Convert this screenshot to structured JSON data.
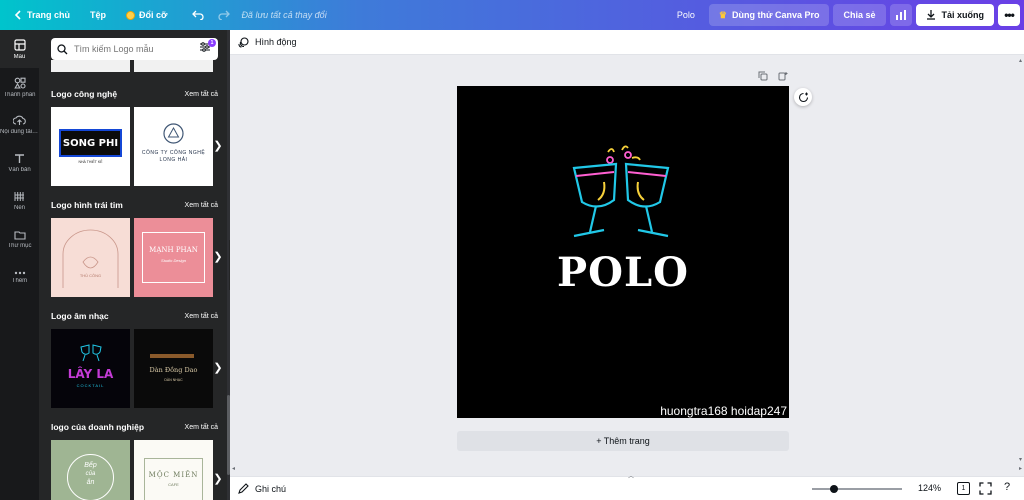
{
  "topbar": {
    "home": "Trang chủ",
    "file": "Tệp",
    "resize": "Đổi cỡ",
    "saved_status": "Đã lưu tất cả thay đổi",
    "design_title": "Polo",
    "try_pro": "Dùng thử Canva Pro",
    "share": "Chia sẻ",
    "download": "Tải xuống"
  },
  "rail": {
    "items": [
      {
        "label": "Mẫu",
        "icon": "template-icon"
      },
      {
        "label": "Thành phần",
        "icon": "elements-icon"
      },
      {
        "label": "Nội dung tải lên",
        "icon": "upload-icon"
      },
      {
        "label": "Văn bản",
        "icon": "text-icon"
      },
      {
        "label": "Nền",
        "icon": "background-icon"
      },
      {
        "label": "Thư mục",
        "icon": "folder-icon"
      },
      {
        "label": "Thêm",
        "icon": "more-icon"
      }
    ]
  },
  "panel": {
    "search_placeholder": "Tìm kiếm Logo mẫu",
    "filter_count": "1",
    "see_all": "Xem tất cả",
    "sections": [
      {
        "title": "Logo công nghệ",
        "t1": {
          "line1": "SONG PHI",
          "line2": "NHÀ THIẾT KẾ"
        },
        "t2": {
          "line1": "CÔNG TY CÔNG NGHỆ",
          "line2": "LONG HẢI"
        }
      },
      {
        "title": "Logo hình trái tim",
        "t1": {
          "line1": "THỦ CÔNG"
        },
        "t2": {
          "line1": "MẠNH PHAN",
          "line2": "Studio Design"
        }
      },
      {
        "title": "Logo âm nhạc",
        "t1": {
          "line1": "LÂY LA",
          "line2": "COCKTAIL"
        },
        "t2": {
          "line1": "Dàn Đồng Dao",
          "line2": "DÀN NHẠC"
        }
      },
      {
        "title": "logo của doanh nghiệp",
        "t1": {
          "line1": "Bếp",
          "line2": "của",
          "line3": "ăn"
        },
        "t2": {
          "line1": "MỘC MIÊN",
          "line2": "CAFE"
        }
      }
    ]
  },
  "editor": {
    "animate": "Hình động",
    "canvas_text": "POLO",
    "watermark": "huongtra168 hoidap247",
    "add_page": "+ Thêm trang"
  },
  "bottom": {
    "notes": "Ghi chú",
    "zoom": "124%",
    "zoom_level": 0.24,
    "page_count": "1"
  },
  "colors": {
    "neon_cyan": "#21c8e8",
    "neon_yellow": "#f7d13a",
    "neon_pink": "#ff5fd2",
    "brand_purple": "#8b3dff"
  }
}
